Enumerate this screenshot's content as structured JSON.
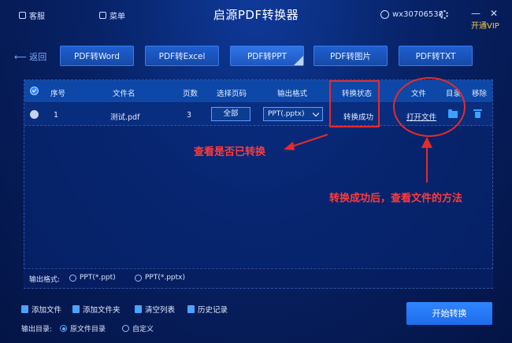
{
  "header": {
    "title": "启源PDF转换器",
    "left_items": [
      {
        "label": "客服",
        "icon": "customer-service-icon"
      },
      {
        "label": "菜单",
        "icon": "menu-icon"
      }
    ],
    "user": "wx30706538",
    "vip": "开通VIP"
  },
  "nav": {
    "back": "返回",
    "tabs": [
      "PDF转Word",
      "PDF转Excel",
      "PDF转PPT",
      "PDF转图片",
      "PDF转TXT"
    ],
    "active_tab": 2
  },
  "table": {
    "headers": [
      "序号",
      "文件名",
      "页数",
      "选择页码",
      "输出格式",
      "转换状态",
      "文件",
      "目录",
      "移除"
    ],
    "rows": [
      {
        "index": "1",
        "filename": "测试.pdf",
        "pages": "3",
        "page_select": "全部",
        "format": "PPT(.pptx)",
        "status": "转换成功",
        "file_action": "打开文件"
      }
    ]
  },
  "annotations": {
    "status_note": "查看是否已转换",
    "file_note": "转换成功后，查看文件的方法",
    "color": "#e62a2a"
  },
  "output_format": {
    "label": "输出格式:",
    "options": [
      "PPT(*.ppt)",
      "PPT(*.pptx)"
    ]
  },
  "toolbar": {
    "add_file": "添加文件",
    "add_folder": "添加文件夹",
    "clear_list": "清空列表",
    "history": "历史记录",
    "start": "开始转换"
  },
  "output_dir": {
    "label": "输出目录:",
    "options": [
      "原文件目录",
      "自定义"
    ],
    "selected": 0
  },
  "colors": {
    "accent": "#2f86ff",
    "header_bg": "#0d48a8",
    "annotation": "#e62a2a"
  }
}
